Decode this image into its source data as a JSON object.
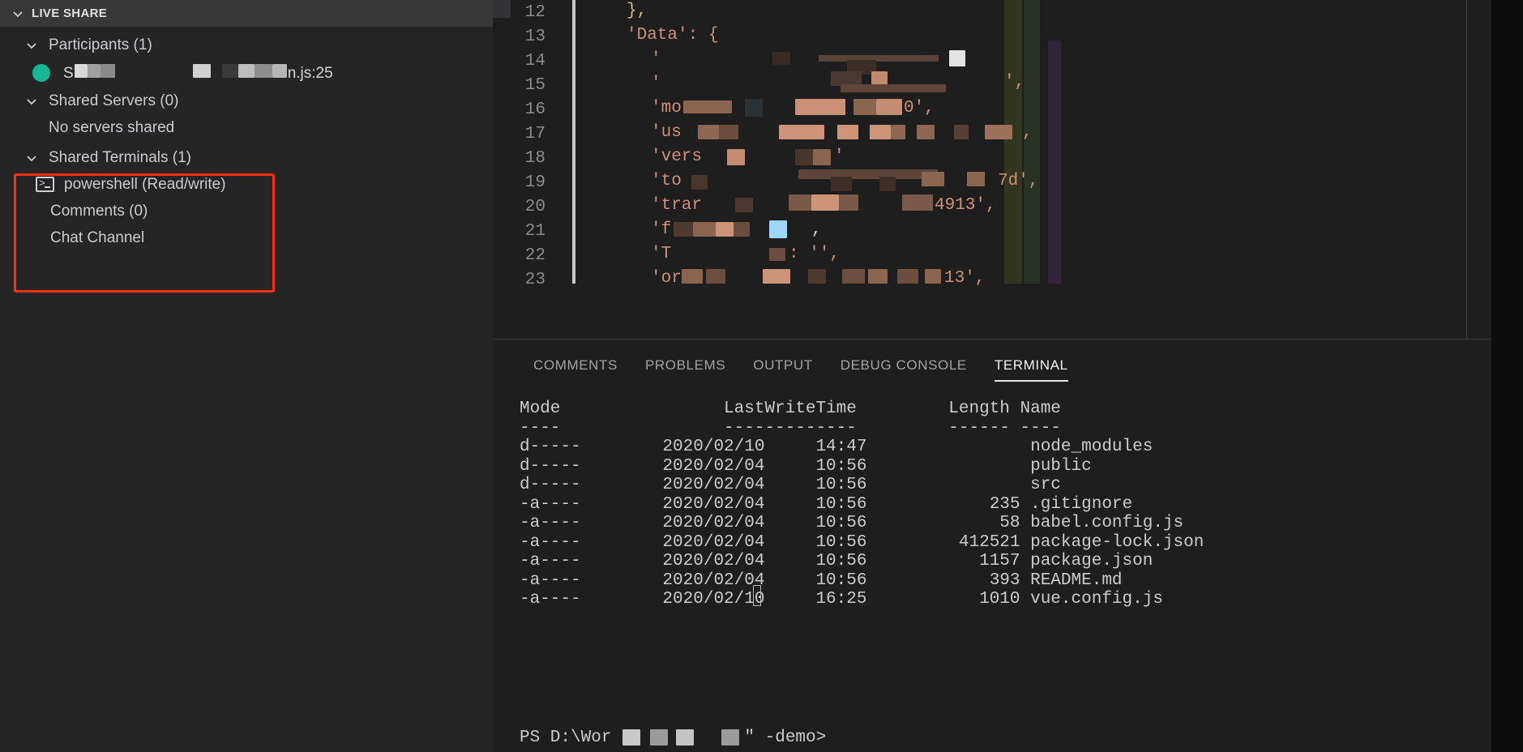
{
  "sidebar": {
    "title": "LIVE SHARE",
    "chevron_icon": "chevron-down-icon",
    "sections": {
      "participants": {
        "label": "Participants (1)",
        "chevron_icon": "chevron-down-icon",
        "member": {
          "status_icon": "online-status-dot",
          "status_color": "#15b796",
          "name_prefix": "S",
          "file_suffix": "n.js:25"
        }
      },
      "shared_servers": {
        "label": "Shared Servers (0)",
        "chevron_icon": "chevron-down-icon",
        "empty_text": "No servers shared"
      },
      "shared_terminals": {
        "label": "Shared Terminals (1)",
        "chevron_icon": "chevron-down-icon",
        "terminal_icon": "terminal-prompt-icon",
        "terminal_label": "powershell (Read/write)"
      },
      "comments": {
        "label": "Comments (0)"
      },
      "chat": {
        "label": "Chat Channel"
      }
    },
    "annotation": {
      "color": "#ff2f16",
      "name": "highlight-rectangle"
    }
  },
  "editor": {
    "lines": [
      {
        "num": "12",
        "text": "},",
        "kind": "brace"
      },
      {
        "num": "13",
        "text": "'Data': {",
        "kind": "key-open"
      },
      {
        "num": "14",
        "text": "'",
        "kind": "redacted"
      },
      {
        "num": "15",
        "text": "'",
        "kind": "redacted"
      },
      {
        "num": "16",
        "text": "'mo",
        "suffix": "0',",
        "kind": "redacted"
      },
      {
        "num": "17",
        "text": "'us",
        "suffix": ",",
        "kind": "redacted"
      },
      {
        "num": "18",
        "text": "'vers",
        "suffix": "'",
        "kind": "redacted"
      },
      {
        "num": "19",
        "text": "'to",
        "suffix": "7d',",
        "kind": "redacted"
      },
      {
        "num": "20",
        "text": "'trar",
        "suffix": "4913',",
        "kind": "redacted"
      },
      {
        "num": "21",
        "text": "'f",
        "suffix": ",",
        "kind": "redacted"
      },
      {
        "num": "22",
        "text": "'T",
        "suffix": ": '',",
        "kind": "redacted"
      },
      {
        "num": "23",
        "text": "'or",
        "suffix": "13',",
        "kind": "redacted"
      }
    ]
  },
  "panel": {
    "tabs": [
      {
        "label": "COMMENTS",
        "active": false
      },
      {
        "label": "PROBLEMS",
        "active": false
      },
      {
        "label": "OUTPUT",
        "active": false
      },
      {
        "label": "DEBUG CONSOLE",
        "active": false
      },
      {
        "label": "TERMINAL",
        "active": true
      }
    ],
    "terminal": {
      "columns": [
        "Mode",
        "LastWriteTime",
        "Length",
        "Name"
      ],
      "header_line": "Mode                LastWriteTime         Length Name",
      "rule_line": "----                -------------         ------ ----",
      "rows": [
        {
          "mode": "d-----",
          "date": "2020/02/10",
          "time": "14:47",
          "length": "",
          "name": "node_modules"
        },
        {
          "mode": "d-----",
          "date": "2020/02/04",
          "time": "10:56",
          "length": "",
          "name": "public"
        },
        {
          "mode": "d-----",
          "date": "2020/02/04",
          "time": "10:56",
          "length": "",
          "name": "src"
        },
        {
          "mode": "-a----",
          "date": "2020/02/04",
          "time": "10:56",
          "length": "235",
          "name": ".gitignore"
        },
        {
          "mode": "-a----",
          "date": "2020/02/04",
          "time": "10:56",
          "length": "58",
          "name": "babel.config.js"
        },
        {
          "mode": "-a----",
          "date": "2020/02/04",
          "time": "10:56",
          "length": "412521",
          "name": "package-lock.json"
        },
        {
          "mode": "-a----",
          "date": "2020/02/04",
          "time": "10:56",
          "length": "1157",
          "name": "package.json"
        },
        {
          "mode": "-a----",
          "date": "2020/02/04",
          "time": "10:56",
          "length": "393",
          "name": "README.md"
        },
        {
          "mode": "-a----",
          "date": "2020/02/10",
          "time": "16:25",
          "length": "1010",
          "name": "vue.config.js"
        }
      ],
      "body_text": "Mode                LastWriteTime         Length Name\n----                -------------         ------ ----\nd-----        2020/02/10     14:47                node_modules\nd-----        2020/02/04     10:56                public\nd-----        2020/02/04     10:56                src\n-a----        2020/02/04     10:56            235 .gitignore\n-a----        2020/02/04     10:56             58 babel.config.js\n-a----        2020/02/04     10:56         412521 package-lock.json\n-a----        2020/02/04     10:56           1157 package.json\n-a----        2020/02/04     10:56            393 README.md\n-a----        2020/02/10     16:25           1010 vue.config.js",
      "prompt_prefix": "PS D:\\Wor",
      "prompt_suffix": "\" -demo>",
      "cursor": "block-cursor"
    }
  }
}
